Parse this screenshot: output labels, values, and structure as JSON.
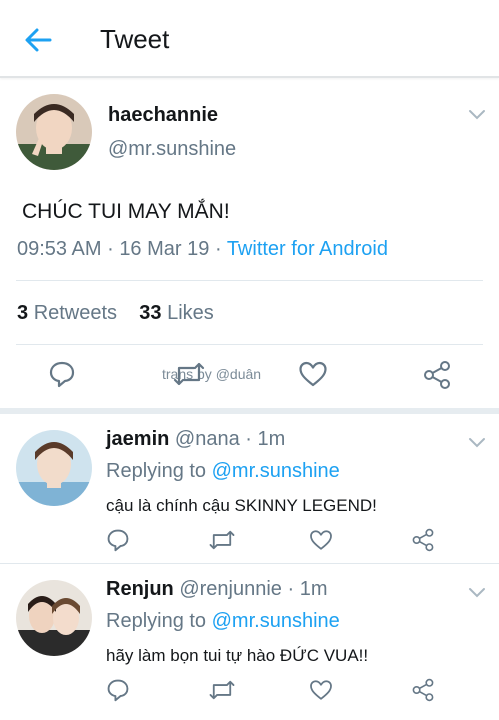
{
  "header": {
    "title": "Tweet",
    "back_icon": "arrow-left-icon",
    "accent": "#1da1f2"
  },
  "tweet": {
    "display_name": "haechannie",
    "handle": "@mr.sunshine",
    "text": "CHÚC TUI MAY MẮN!",
    "time": "09:53 AM",
    "date": "16 Mar 19",
    "sep": "·",
    "source": "Twitter for Android",
    "retweets_count": "3",
    "retweets_label": "Retweets",
    "likes_count": "33",
    "likes_label": "Likes",
    "watermark": "trans by @duân"
  },
  "replies": [
    {
      "display_name": "jaemin",
      "handle": "@nana",
      "time": "1m",
      "replying_label": "Replying to",
      "replying_to": "@mr.sunshine",
      "text": "cậu là chính cậu SKINNY LEGEND!"
    },
    {
      "display_name": "Renjun",
      "handle": "@renjunnie",
      "time": "1m",
      "replying_label": "Replying to",
      "replying_to": "@mr.sunshine",
      "text": "hãy làm bọn tui tự hào ĐỨC VUA!!"
    }
  ]
}
